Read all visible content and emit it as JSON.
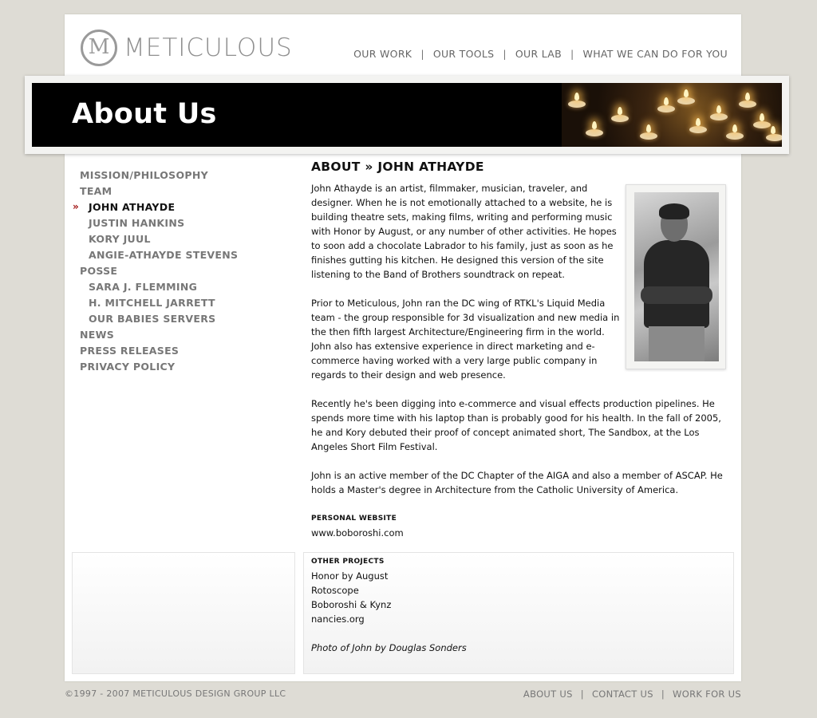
{
  "brand": {
    "name": "METICULOUS",
    "mark": "M"
  },
  "topnav": [
    "OUR WORK",
    "OUR TOOLS",
    "OUR LAB",
    "WHAT WE CAN DO FOR YOU"
  ],
  "nav_separator": "|",
  "banner": {
    "title": "About Us"
  },
  "sidenav": {
    "active_marker": "»",
    "items": [
      "MISSION/PHILOSOPHY",
      "TEAM",
      "JOHN ATHAYDE",
      "JUSTIN HANKINS",
      "KORY JUUL",
      "ANGIE-ATHAYDE STEVENS",
      "POSSE",
      "SARA J. FLEMMING",
      "H. MITCHELL JARRETT",
      "OUR BABIES SERVERS",
      "NEWS",
      "PRESS RELEASES",
      "PRIVACY POLICY"
    ]
  },
  "content": {
    "heading": "ABOUT » JOHN ATHAYDE",
    "p1": "John Athayde is an artist, filmmaker, musician, traveler, and designer. When he is not emotionally attached to a website, he is building theatre sets, making films, writing and performing music with Honor by August, or any number of other activities. He hopes to soon add a chocolate Labrador to his family, just as soon as he finishes gutting his kitchen. He designed this version of the site listening to the Band of Brothers soundtrack on repeat.",
    "p2": "Prior to Meticulous, John ran the DC wing of RTKL's Liquid Media team - the group responsible for 3d visualization and new media in the then fifth largest Architecture/Engineering firm in the world. John also has extensive experience in direct marketing and e-commerce having worked with a very large public company in regards to their design and web presence.",
    "p3": "Recently he's been digging into e-commerce and visual effects production pipelines. He spends more time with his laptop than is probably good for his health. In the fall of 2005, he and Kory debuted their proof of concept animated short, The Sandbox, at the Los Angeles Short Film Festival.",
    "p4": "John is an active member of the DC Chapter of the AIGA and also a member of ASCAP. He holds a Master's degree in Architecture from the Catholic University of America.",
    "website_heading": "PERSONAL WEBSITE",
    "website": "www.boboroshi.com",
    "projects_heading": "OTHER PROJECTS",
    "projects": [
      "Honor by August",
      "Rotoscope",
      "Boboroshi & Kynz",
      "nancies.org"
    ],
    "credit": "Photo of John by Douglas Sonders"
  },
  "footer": {
    "copyright": "©1997 - 2007 METICULOUS DESIGN GROUP LLC",
    "links": [
      "ABOUT US",
      "CONTACT US",
      "WORK FOR US"
    ]
  }
}
